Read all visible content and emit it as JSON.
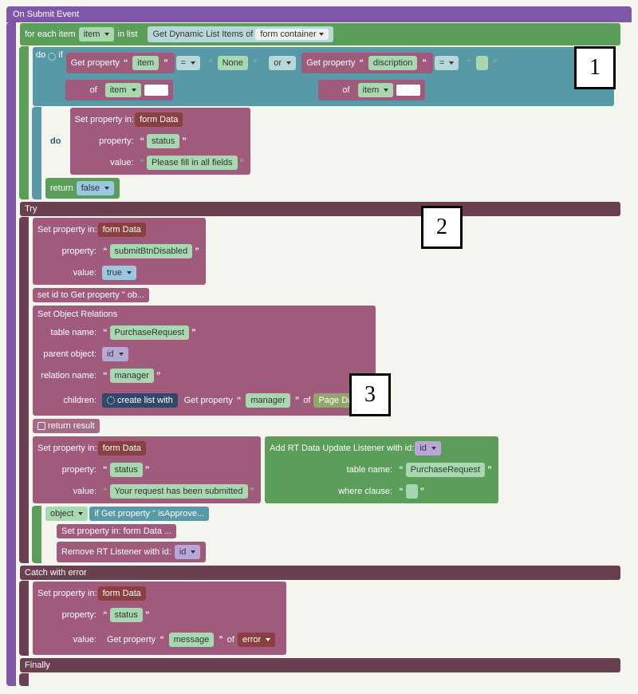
{
  "header": "On Submit Event",
  "forEach": {
    "label": "for each item",
    "var": "item",
    "in": "in list",
    "get": "Get Dynamic List Items of",
    "target": "form container"
  },
  "do": "do",
  "if": "if",
  "or": "or",
  "cond1": {
    "get": "Get property",
    "propQuote": "item",
    "of": "of",
    "target": "item",
    "eq": "=",
    "none": "None"
  },
  "cond2": {
    "get": "Get property",
    "propQuote": "discription",
    "of": "of",
    "target": "item",
    "eq": "="
  },
  "doLbl": "do",
  "set1": {
    "set": "Set property in:",
    "obj": "form Data",
    "property": "property:",
    "propVal": "status",
    "value": "value:",
    "valVal": "Please fill in all fields"
  },
  "return": {
    "label": "return",
    "val": "false"
  },
  "try": "Try",
  "set2": {
    "set": "Set property in:",
    "obj": "form Data",
    "property": "property:",
    "propVal": "submitBtnDisabled",
    "value": "value:",
    "valVal": "true"
  },
  "setId": "set id to Get property \" ob...",
  "relations": {
    "title": "Set Object Relations",
    "tableName": "table name:",
    "tableVal": "PurchaseRequest",
    "parent": "parent object:",
    "parentVal": "id",
    "relName": "relation name:",
    "relVal": "manager",
    "children": "children:",
    "create": "create list with",
    "getProp": "Get property",
    "mgr": "manager",
    "of": "of",
    "page": "Page Data"
  },
  "returnResult": "return result",
  "set3": {
    "set": "Set property in:",
    "obj": "form Data",
    "property": "property:",
    "propVal": "status",
    "value": "value:",
    "valVal": "Your request has been submitted"
  },
  "listener": {
    "add": "Add RT Data Update Listener with id:",
    "id": "id",
    "tableName": "table name:",
    "tableVal": "PurchaseRequest",
    "where": "where clause:",
    "object": "object",
    "ifGet": "if Get property \" isApprove...",
    "setForm": "Set property in: form Data ...",
    "remove": "Remove RT Listener with id:",
    "removeId": "id"
  },
  "catch": {
    "label": "Catch with error",
    "set": "Set property in:",
    "obj": "form Data",
    "property": "property:",
    "propVal": "status",
    "value": "value:",
    "getProp": "Get property",
    "msg": "message",
    "of": "of",
    "err": "error"
  },
  "finally": "Finally",
  "annotations": {
    "a1": "1",
    "a2": "2",
    "a3": "3"
  }
}
